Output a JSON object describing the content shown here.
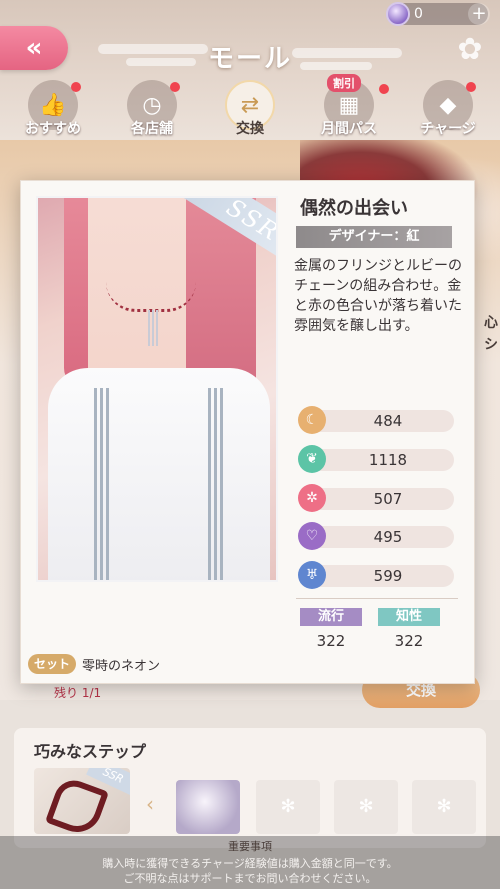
{
  "header": {
    "title": "モール",
    "currency_amount": "0",
    "back_label": "«",
    "plus_label": "+"
  },
  "tabs": [
    {
      "label": "おすすめ",
      "icon": "thumbs-up-icon",
      "active": false,
      "red_dot": true
    },
    {
      "label": "各店舗",
      "icon": "clock-icon",
      "active": false,
      "red_dot": true
    },
    {
      "label": "交換",
      "icon": "exchange-icon",
      "active": true,
      "red_dot": false
    },
    {
      "label": "月間パス",
      "icon": "calendar-icon",
      "active": false,
      "red_dot": true,
      "badge": "割引"
    },
    {
      "label": "チャージ",
      "icon": "diamond-icon",
      "active": false,
      "red_dot": true
    }
  ],
  "item": {
    "name": "偶然の出会い",
    "rarity": "SSR",
    "designer": "デザイナー：紅",
    "description": "金属のフリンジとルビーのチェーンの組み合わせ。金と赤の色合いが落ち着いた雰囲気を醸し出す。",
    "stats": [
      {
        "icon": "elegance-icon",
        "color": "#e7b070",
        "value": "484"
      },
      {
        "icon": "freshness-icon",
        "color": "#5cc4a6",
        "value": "1118"
      },
      {
        "icon": "sweetness-icon",
        "color": "#ee6f86",
        "value": "507"
      },
      {
        "icon": "sexy-icon",
        "color": "#9a6cc6",
        "value": "495"
      },
      {
        "icon": "cool-icon",
        "color": "#5f86d0",
        "value": "599"
      }
    ],
    "tags": [
      {
        "label": "流行",
        "color": "#a58cc4",
        "value": "322"
      },
      {
        "label": "知性",
        "color": "#7fc7c2",
        "value": "322"
      }
    ],
    "set_badge": "セット",
    "set_name": "零時のネオン"
  },
  "background": {
    "remaining": "残り 1/1",
    "exchange_button": "交換",
    "section_title": "巧みなステップ",
    "side_text": "心シ"
  },
  "footer": {
    "title": "重要事項",
    "line1": "購入時に獲得できるチャージ経験値は購入金額と同一です。",
    "line2": "ご不明な点はサポートまでお問い合わせください。"
  }
}
